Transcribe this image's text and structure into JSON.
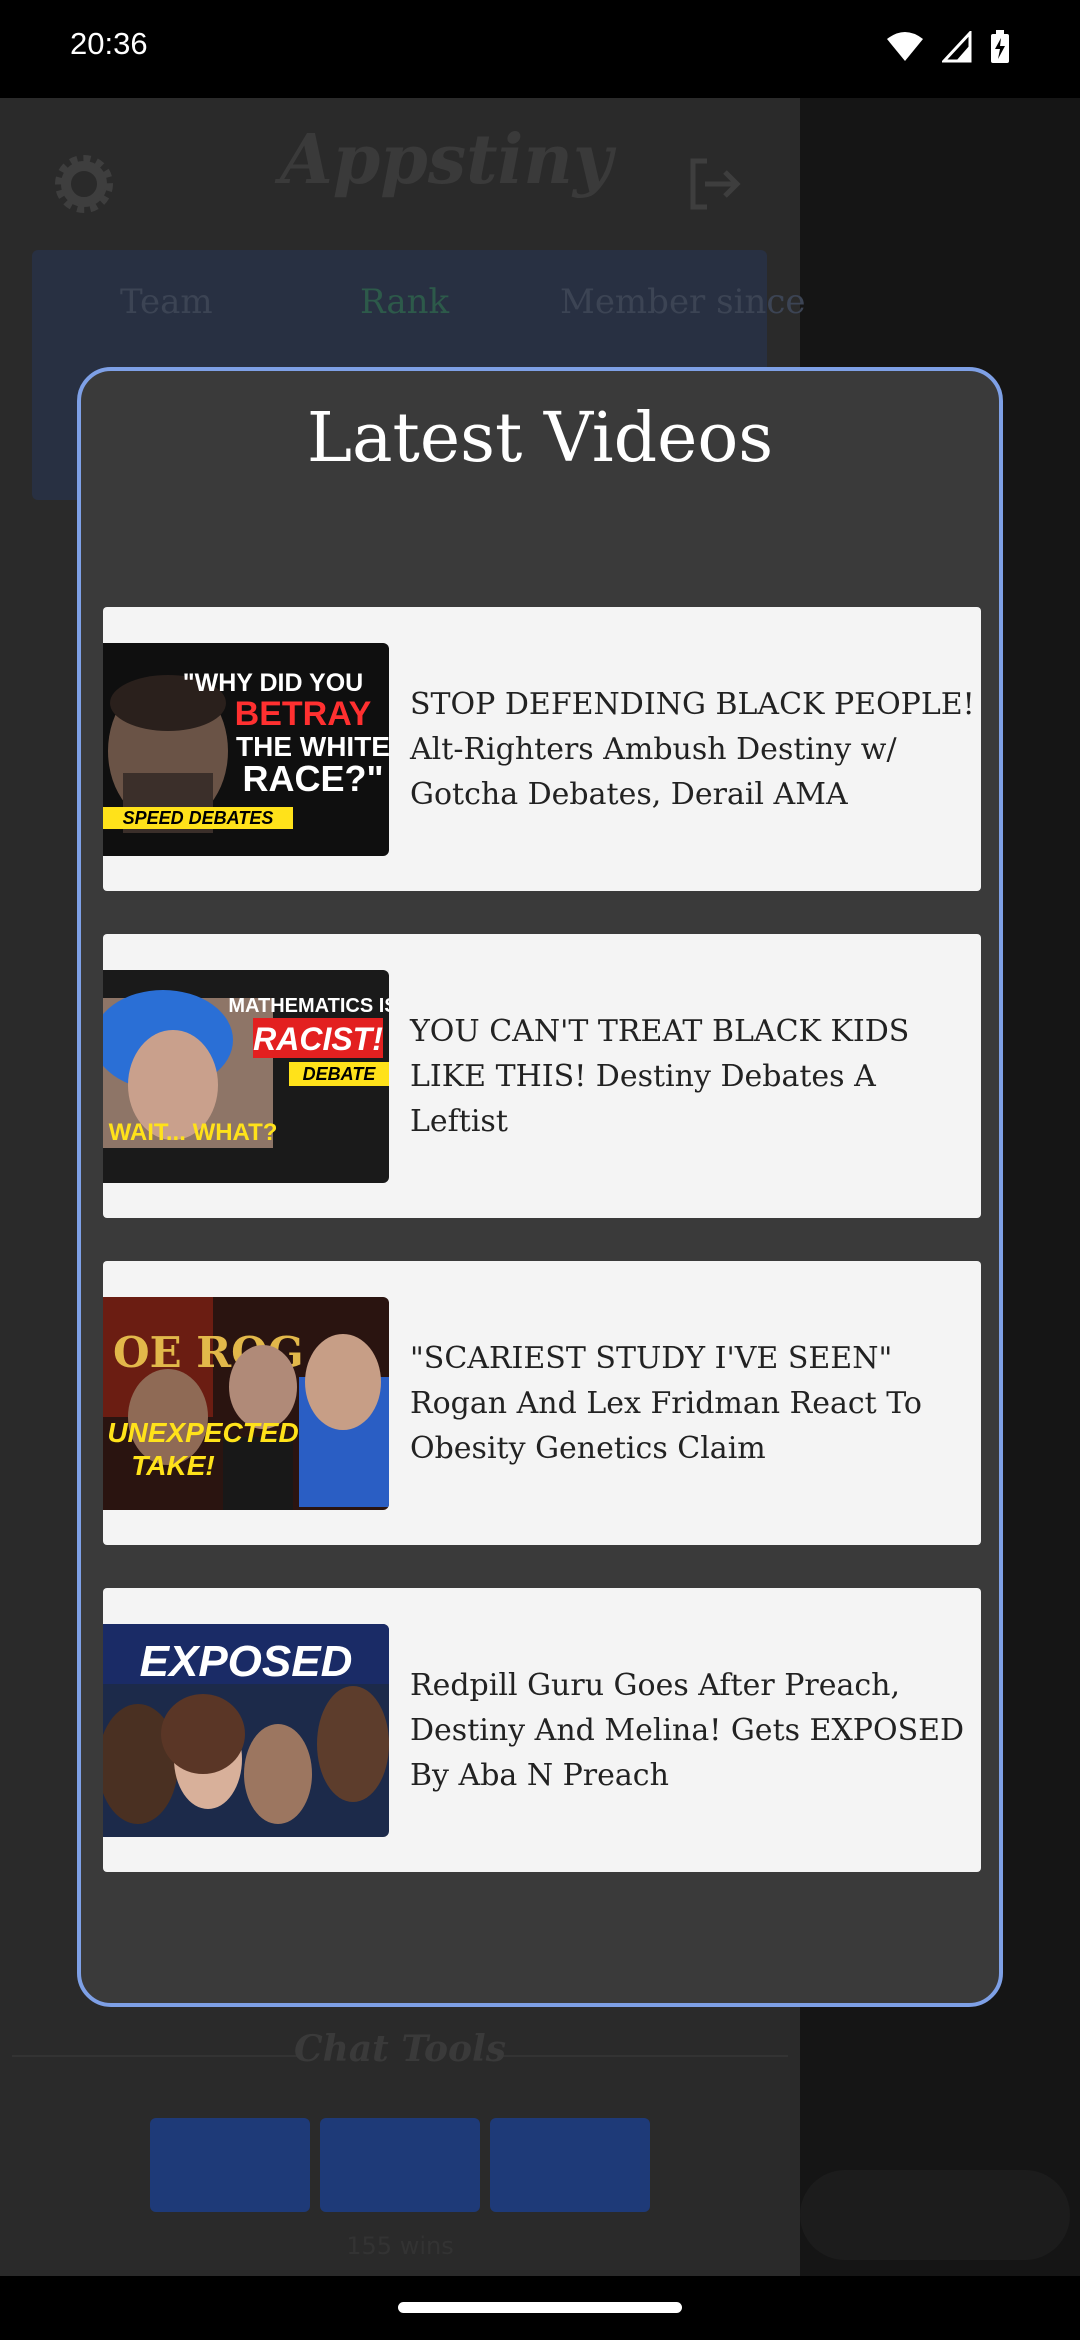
{
  "status_bar": {
    "time": "20:36"
  },
  "background_app": {
    "logo": "Appstiny",
    "columns": [
      "Team",
      "Rank",
      "Member since"
    ],
    "chat_tools_label": "Chat Tools",
    "footer_text": "155 wins"
  },
  "modal": {
    "title": "Latest Videos",
    "videos": [
      {
        "title": "STOP DEFENDING BLACK PEOPLE! Alt-Righters Ambush Destiny w/ Gotcha Debates, Derail AMA",
        "thumb_lines": [
          "\"WHY DID YOU",
          "BETRAY",
          "THE WHITE",
          "RACE?\""
        ],
        "thumb_tag": "SPEED DEBATES"
      },
      {
        "title": "YOU CAN'T TREAT BLACK KIDS LIKE THIS! Destiny Debates A Leftist",
        "thumb_lines": [
          "MATHEMATICS IS",
          "RACIST!",
          "DEBATE",
          "WAIT... WHAT?"
        ]
      },
      {
        "title": "\"SCARIEST STUDY I'VE SEEN\" Rogan And Lex Fridman React To Obesity Genetics Claim",
        "thumb_lines": [
          "UNEXPECTED",
          "TAKE!"
        ]
      },
      {
        "title": "Redpill Guru Goes After Preach, Destiny And Melina! Gets EXPOSED By Aba N Preach",
        "thumb_lines": [
          "EXPOSED"
        ]
      }
    ]
  }
}
